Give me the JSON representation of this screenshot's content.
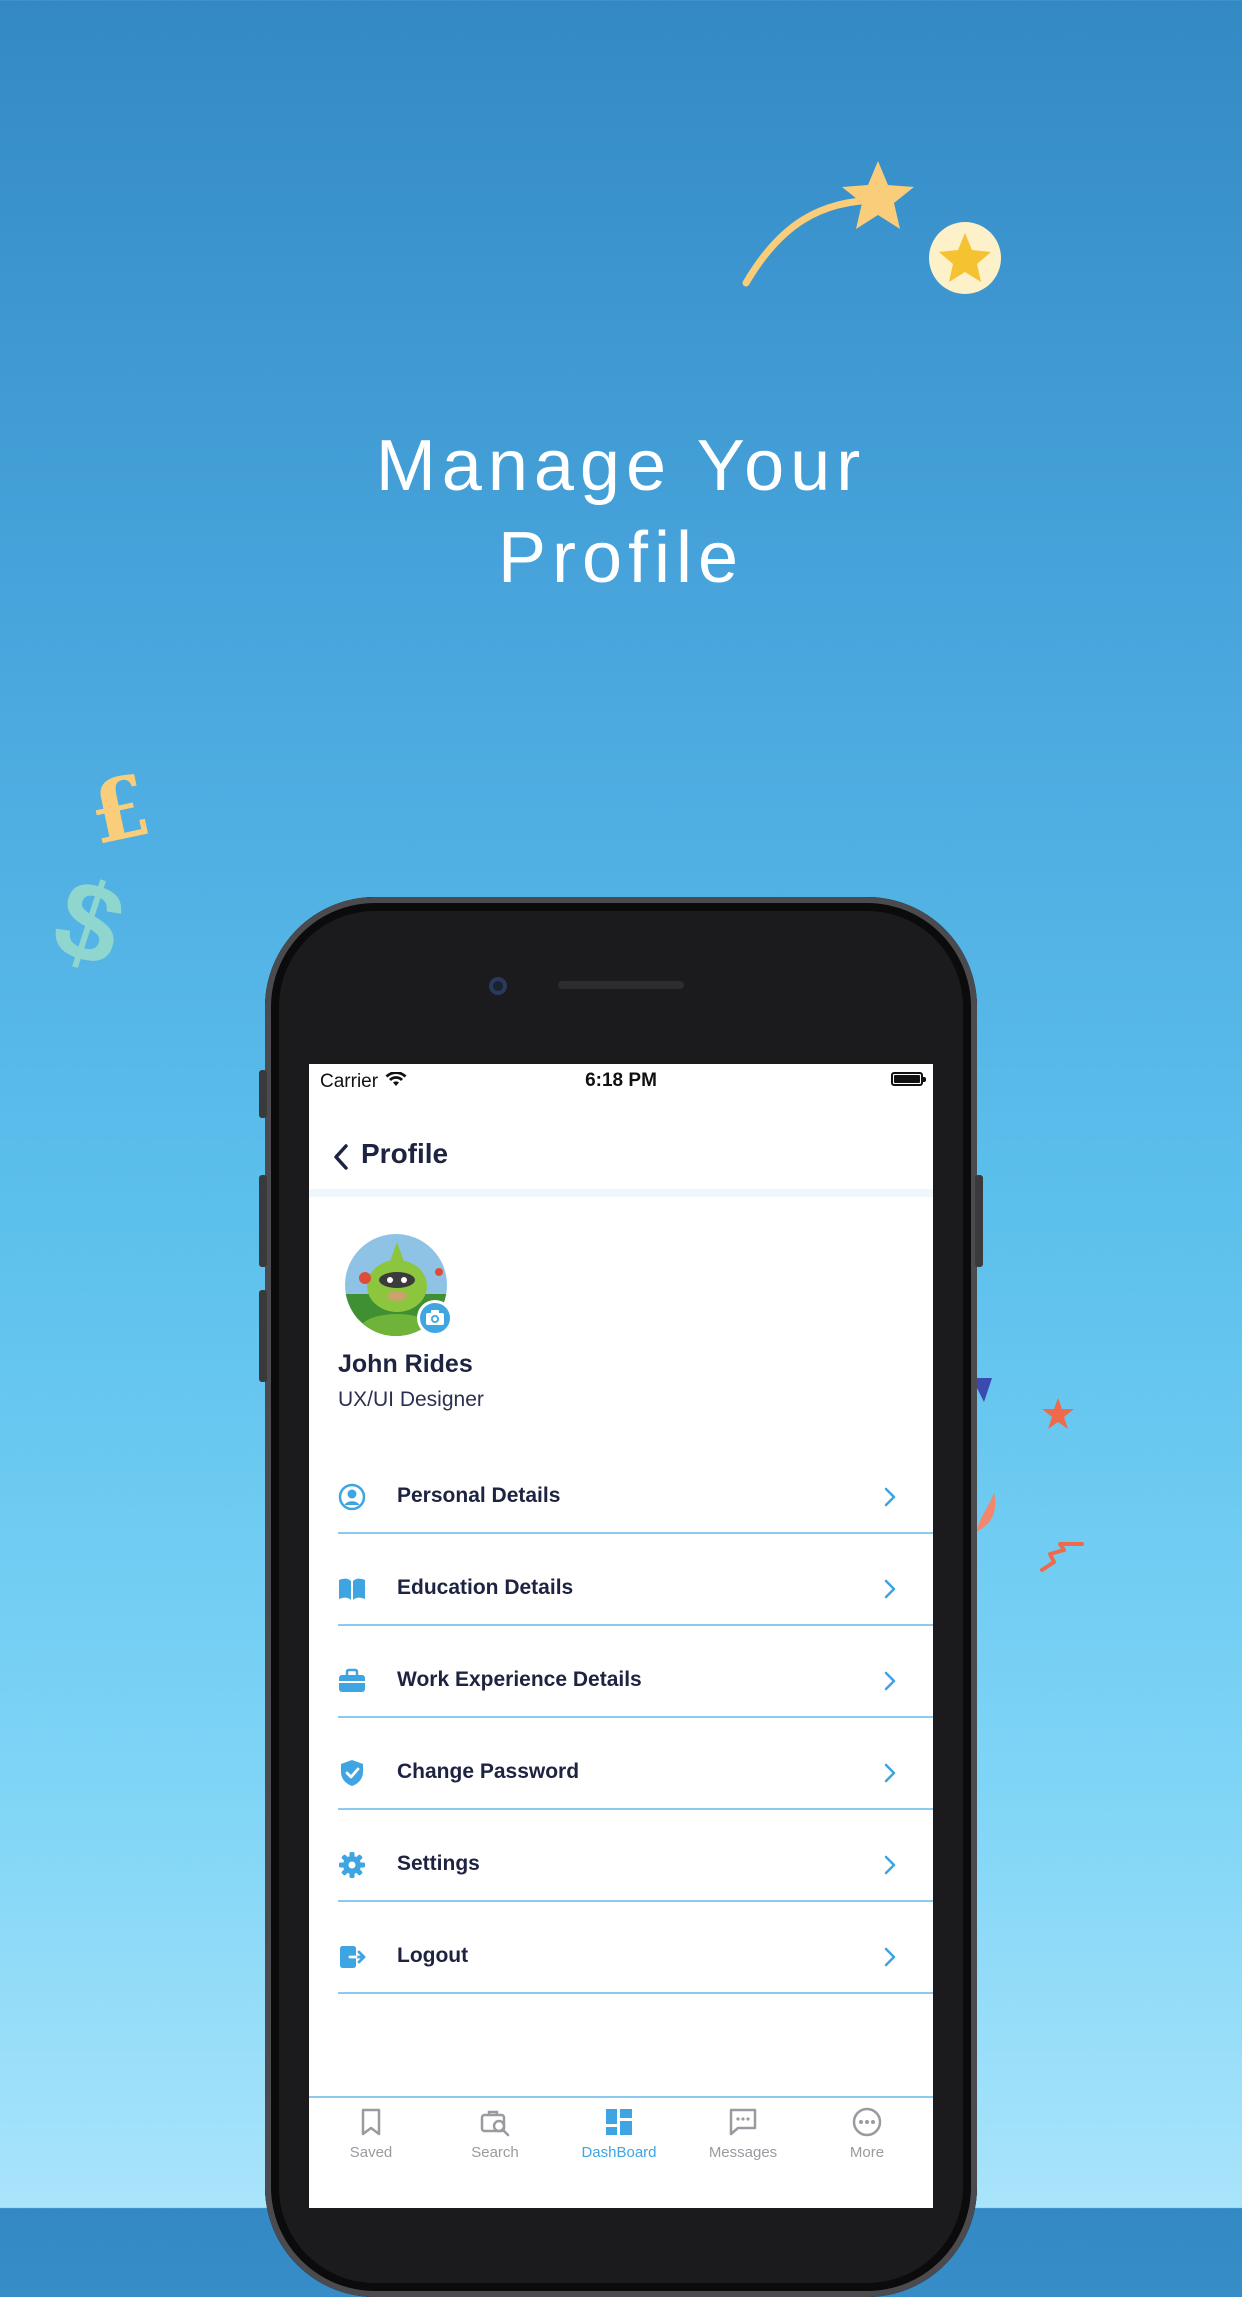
{
  "headline": {
    "line1": "Manage Your",
    "line2": "Profile"
  },
  "decorations": {
    "pound_symbol": "£",
    "dollar_symbol": "$"
  },
  "status_bar": {
    "carrier": "Carrier",
    "time": "6:18 PM"
  },
  "nav": {
    "title": "Profile",
    "back_icon": "chevron-left-icon"
  },
  "profile": {
    "name": "John Rides",
    "role": "UX/UI Designer"
  },
  "menu": [
    {
      "label": "Personal Details",
      "icon": "user-circle-icon"
    },
    {
      "label": "Education Details",
      "icon": "book-icon"
    },
    {
      "label": "Work Experience Details",
      "icon": "briefcase-icon"
    },
    {
      "label": "Change Password",
      "icon": "shield-check-icon"
    },
    {
      "label": "Settings",
      "icon": "gear-icon"
    },
    {
      "label": "Logout",
      "icon": "logout-icon"
    }
  ],
  "tabs": [
    {
      "label": "Saved",
      "icon": "bookmark-icon",
      "active": false
    },
    {
      "label": "Search",
      "icon": "briefcase-search-icon",
      "active": false
    },
    {
      "label": "DashBoard",
      "icon": "dashboard-icon",
      "active": true
    },
    {
      "label": "Messages",
      "icon": "message-icon",
      "active": false
    },
    {
      "label": "More",
      "icon": "more-icon",
      "active": false
    }
  ],
  "colors": {
    "accent": "#3ea4e2",
    "text_dark": "#1d2340",
    "inactive": "#9a9aa0"
  }
}
